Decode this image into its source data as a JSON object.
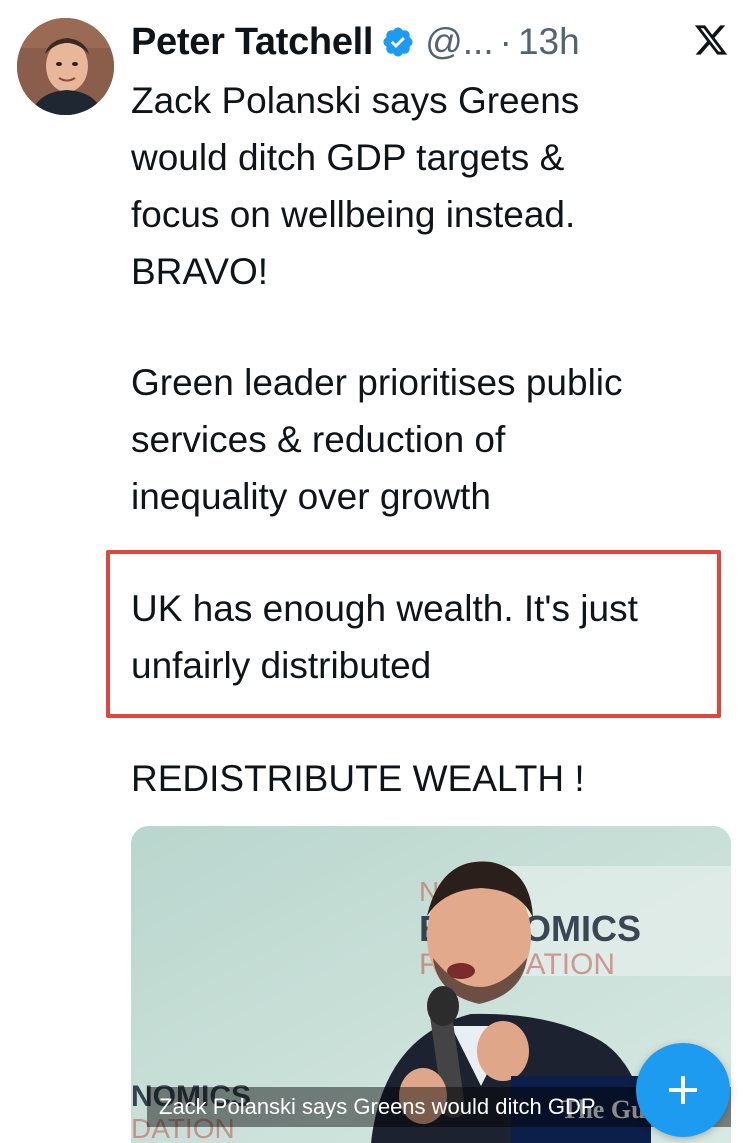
{
  "tweet": {
    "author": {
      "display_name": "Peter Tatchell",
      "handle": "@...",
      "verified": true,
      "avatar_icon": "user-avatar"
    },
    "separator": "·",
    "timestamp": "13h",
    "platform_icon": "x-logo-icon",
    "paragraphs": [
      "Zack Polanski says Greens\nwould ditch GDP targets &\nfocus on wellbeing instead.\nBRAVO!",
      "Green leader prioritises public\nservices & reduction of\ninequality over growth",
      "UK has enough wealth. It's just\nunfairly distributed",
      "REDISTRIBUTE WEALTH !"
    ],
    "media": {
      "caption": "Zack Polanski says Greens would ditch GDP",
      "backdrop_text_top": [
        "NE",
        "ECONOMICS",
        "FOUNDATION"
      ],
      "backdrop_text_bottom": [
        "NOMICS",
        "DATION"
      ],
      "publisher_badge": "The Guardian"
    }
  },
  "fab": {
    "icon": "plus-icon",
    "label": "+"
  },
  "colors": {
    "text_primary": "#0f1419",
    "text_secondary": "#536471",
    "verified_blue": "#1d9bf0",
    "highlight_border": "#e0473c",
    "fab_background": "#1d9bf0"
  }
}
